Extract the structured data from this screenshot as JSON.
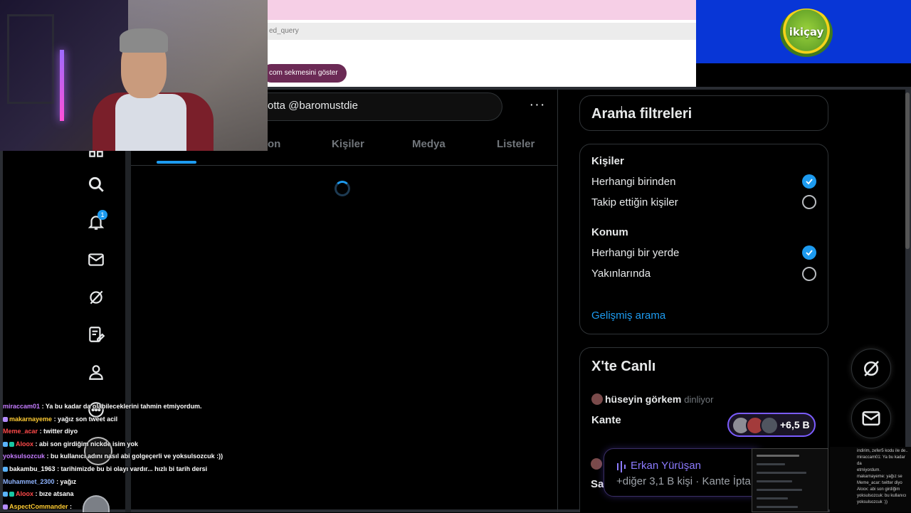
{
  "browser": {
    "url_fragment": "ed_query",
    "show_tab_label": "com sekmesini göster"
  },
  "sponsor_logo": {
    "text": "ikiçay",
    "colors": {
      "bg": "#0836d6",
      "green": "#6aa82a",
      "ring": "#f4d21a"
    }
  },
  "search": {
    "query": "otta @baromustdie",
    "more_label": "···"
  },
  "tabs": [
    {
      "label": "on"
    },
    {
      "label": "Kişiler"
    },
    {
      "label": "Medya"
    },
    {
      "label": "Listeler"
    }
  ],
  "nav": {
    "notification_count": "1",
    "icons": [
      "grok-icon",
      "search-icon",
      "bell-icon",
      "mail-icon",
      "grok-icon",
      "compose-list-icon",
      "profile-icon",
      "more-circle-icon"
    ]
  },
  "filters": {
    "title": "Arama filtreleri",
    "people_heading": "Kişiler",
    "people_options": [
      {
        "label": "Herhangi birinden",
        "selected": true
      },
      {
        "label": "Takip ettiğin kişiler",
        "selected": false
      }
    ],
    "location_heading": "Konum",
    "location_options": [
      {
        "label": "Herhangi bir yerde",
        "selected": true
      },
      {
        "label": "Yakınlarında",
        "selected": false
      }
    ],
    "advanced_link": "Gelişmiş arama"
  },
  "live": {
    "title": "X'te Canlı",
    "host": "hüseyin görkem",
    "host_status": "dinliyor",
    "space_title": "Kante",
    "listeners": "+6,5 B"
  },
  "spaces_dock": {
    "speaker": "Erkan Yürüşan",
    "subtitle": "+diğer 3,1 B kişi · Kante İpta",
    "left_partial": "Sal"
  },
  "chat": [
    {
      "user": "miraccam01",
      "color": "purple",
      "text": ": Ya bu kadar da olabileceklerini tahmin etmiyordum."
    },
    {
      "user": "makarnayeme",
      "color": "yellow",
      "text": ": yağız son tweet acil",
      "badge": "heart"
    },
    {
      "user": "Meme_acar",
      "color": "red",
      "text": ": twitter diyo"
    },
    {
      "user": "Aloox",
      "color": "red",
      "text": ": abi son girdiğim nickde isim yok",
      "badge": "double"
    },
    {
      "user": "yoksulsozcuk",
      "color": "purple",
      "text": ": bu kullanıcı adını nasıl abi golgeçerli ve yoksulsozcuk :))"
    },
    {
      "user": "bakambu_1963",
      "color": "white",
      "text": ": tarihimizde bu bi olayı vardır... hızlı bi tarih dersi",
      "badge": "single"
    },
    {
      "user": "Muhammet_2300",
      "color": "blue",
      "text": ": yağız"
    },
    {
      "user": "Aloox",
      "color": "red",
      "text": ": bıze atsana",
      "badge": "double"
    },
    {
      "user": "AspectCommander",
      "color": "yellow",
      "text": ":",
      "badge": "heart"
    }
  ],
  "mini_chat": [
    "indirim, zefer5 kodu ile de..",
    "miraccam01: Ya bu kadar da",
    "etmiyordum.",
    "makarnayeme: yağız se",
    "Meme_acar: twitter diyo",
    "Aloox: abi son girdiğim",
    "yoksulsozcuk: bu kullanıcı",
    "yoksulsozcuk :))"
  ]
}
